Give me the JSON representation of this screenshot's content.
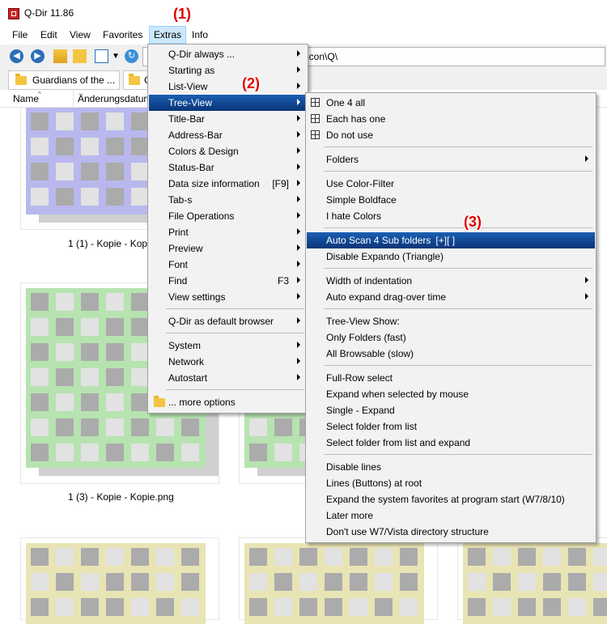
{
  "window": {
    "title": "Q-Dir 11.86"
  },
  "menubar": {
    "items": [
      "File",
      "Edit",
      "View",
      "Favorites",
      "Extras",
      "Info"
    ]
  },
  "address": {
    "path": "g\\icon\\Q\\"
  },
  "tabs": [
    {
      "label": "Guardians of the ..."
    },
    {
      "label": "C"
    }
  ],
  "columns": {
    "name": "Name",
    "date": "Änderungsdatum"
  },
  "files": [
    {
      "caption": "1 (1) - Kopie - Kopie",
      "color": "#b8b8ee"
    },
    {
      "caption": "1 (3) - Kopie - Kopie.png",
      "color": "#b6e3b0"
    },
    {
      "caption": "",
      "color": "#e8e4b4"
    }
  ],
  "annotations": [
    "(1)",
    "(2)",
    "(3)"
  ],
  "extras_menu": {
    "items": [
      {
        "label": "Q-Dir always ...",
        "submenu": true
      },
      {
        "label": "Starting as",
        "submenu": true
      },
      {
        "label": "List-View",
        "submenu": true
      },
      {
        "label": "Tree-View",
        "submenu": true,
        "highlighted": true
      },
      {
        "label": "Title-Bar",
        "submenu": true
      },
      {
        "label": "Address-Bar",
        "submenu": true
      },
      {
        "label": "Colors & Design",
        "submenu": true
      },
      {
        "label": "Status-Bar",
        "submenu": true
      },
      {
        "label": "Data size information",
        "shortcut": "[F9]",
        "submenu": true
      },
      {
        "label": "Tab-s",
        "submenu": true
      },
      {
        "label": "File Operations",
        "submenu": true
      },
      {
        "label": "Print",
        "submenu": true
      },
      {
        "label": "Preview",
        "submenu": true
      },
      {
        "label": "Font",
        "submenu": true
      },
      {
        "label": "Find",
        "shortcut": "F3",
        "submenu": true
      },
      {
        "label": "View settings",
        "submenu": true
      },
      {
        "label": "Q-Dir as default browser",
        "submenu": true
      },
      {
        "label": "System",
        "submenu": true
      },
      {
        "label": "Network",
        "submenu": true
      },
      {
        "label": "Autostart",
        "submenu": true
      },
      {
        "label": "... more options",
        "icon": "folder-icon"
      }
    ]
  },
  "treeview_menu": {
    "items": [
      {
        "label": "One 4 all",
        "icon": "grid-icon"
      },
      {
        "label": "Each has one",
        "icon": "grid-icon"
      },
      {
        "label": "Do not use",
        "icon": "grid-icon"
      },
      {
        "label": "Folders",
        "submenu": true
      },
      {
        "label": "Use Color-Filter"
      },
      {
        "label": "Simple Boldface"
      },
      {
        "label": "I hate Colors"
      },
      {
        "label": "Auto Scan 4 Sub folders",
        "shortcut": "[+][ ]",
        "highlighted": true
      },
      {
        "label": "Disable Expando (Triangle)"
      },
      {
        "label": "Width of indentation",
        "submenu": true
      },
      {
        "label": "Auto expand drag-over time",
        "submenu": true
      },
      {
        "label": "Tree-View Show:"
      },
      {
        "label": "Only Folders (fast)"
      },
      {
        "label": "All Browsable (slow)"
      },
      {
        "label": "Full-Row select"
      },
      {
        "label": "Expand when selected by mouse"
      },
      {
        "label": "Single - Expand"
      },
      {
        "label": "Select folder from list"
      },
      {
        "label": "Select folder from list and expand"
      },
      {
        "label": "Disable lines"
      },
      {
        "label": "Lines (Buttons) at root"
      },
      {
        "label": "Expand the system favorites at program start (W7/8/10)"
      },
      {
        "label": "Later more"
      },
      {
        "label": "Don't use W7/Vista directory structure"
      }
    ]
  }
}
